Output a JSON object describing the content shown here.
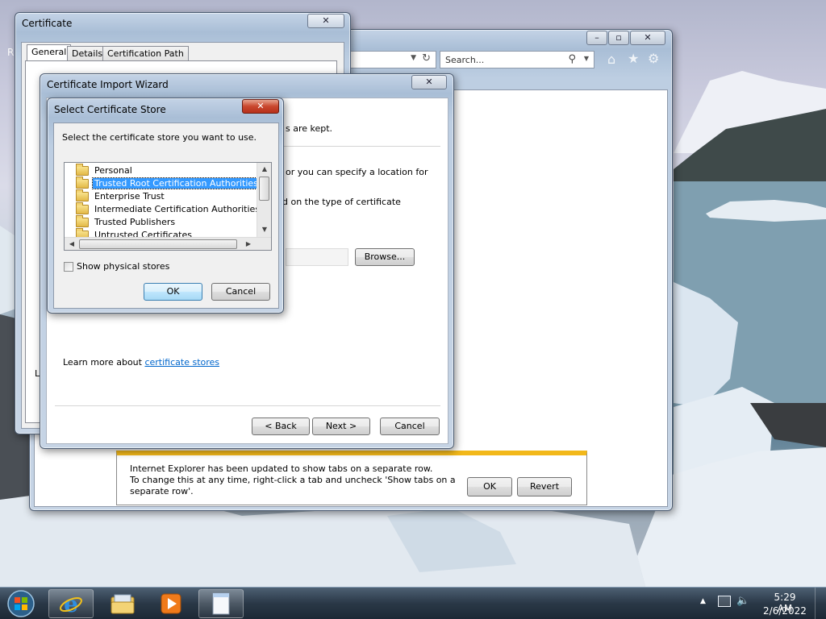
{
  "desktop": {
    "bg_letter": "R"
  },
  "ie": {
    "search_placeholder": "Search...",
    "caption": {
      "minimize": "–",
      "maximize": "▫",
      "close": "✕"
    },
    "notify": {
      "line1": "Internet Explorer has been updated to show tabs on a separate row.",
      "line2": "To change this at any time, right-click a tab and uncheck 'Show tabs on a",
      "line3": "separate row'.",
      "ok": "OK",
      "revert": "Revert"
    }
  },
  "cert_window": {
    "title": "Certificate",
    "close": "✕",
    "tabs": [
      "General",
      "Details",
      "Certification Path"
    ],
    "left_fragment": "Le"
  },
  "wizard": {
    "title": "Certificate Import Wizard",
    "close": "✕",
    "frag1": "s are kept.",
    "frag2": "or you can specify a location for",
    "frag3": "d on the type of certificate",
    "browse": "Browse...",
    "learn_prefix": "Learn more about ",
    "learn_link": "certificate stores",
    "back": "< Back",
    "next": "Next >",
    "cancel": "Cancel"
  },
  "store_dialog": {
    "title": "Select Certificate Store",
    "close": "✕",
    "prompt": "Select the certificate store you want to use.",
    "items": [
      "Personal",
      "Trusted Root Certification Authorities",
      "Enterprise Trust",
      "Intermediate Certification Authorities",
      "Trusted Publishers",
      "Untrusted Certificates"
    ],
    "selected_index": 1,
    "show_physical": "Show physical stores",
    "show_physical_checked": false,
    "ok": "OK",
    "cancel": "Cancel"
  },
  "taskbar": {
    "time": "5:29 AM",
    "date": "2/6/2022"
  }
}
